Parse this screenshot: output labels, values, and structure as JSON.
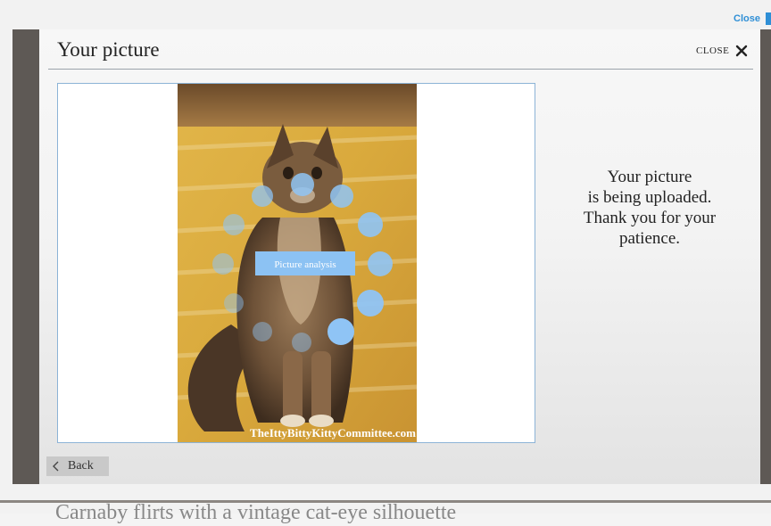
{
  "modal": {
    "title": "Your picture",
    "close_label": "CLOSE",
    "back_label": "Back"
  },
  "background_page": {
    "close_link": "Close",
    "bottom_text": "Carnaby flirts with a vintage cat-eye silhouette"
  },
  "photo": {
    "watermark": "TheIttyBittyKittyCommittee.com",
    "analysis_label": "Picture analysis"
  },
  "upload_message": {
    "lines": [
      "Your picture",
      "is being uploaded.",
      "Thank you for your",
      "patience."
    ]
  },
  "colors": {
    "accent_blue": "#2f8fd6",
    "spinner_blue": "#8fc4f5",
    "analysis_box": "#8cc2f3",
    "frame_border": "#8cb3d6"
  },
  "icons": {
    "close": "close-icon",
    "back": "chevron-left-icon",
    "spinner": "loading-spinner"
  }
}
